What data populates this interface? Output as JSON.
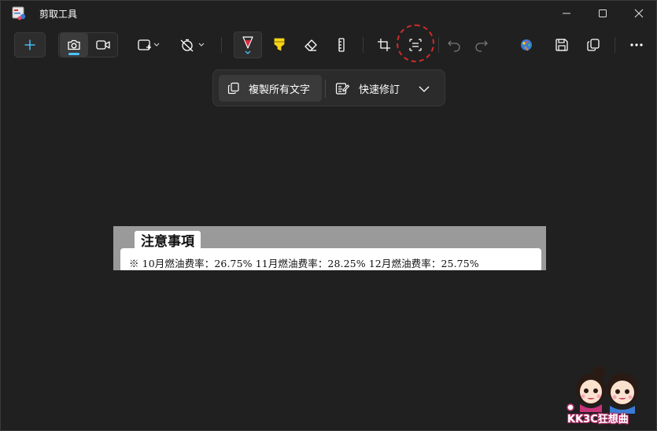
{
  "window": {
    "title": "剪取工具",
    "controls": {
      "minimize": "minimize-icon",
      "maximize": "maximize-icon",
      "close": "close-icon"
    }
  },
  "toolbar": {
    "buttons": [
      {
        "name": "new-snip",
        "icon": "plus-icon"
      },
      {
        "name": "snip-photo-mode",
        "icon": "camera-icon",
        "selected": true
      },
      {
        "name": "snip-video-mode",
        "icon": "video-camera-icon"
      },
      {
        "name": "snip-shape",
        "icon": "rectangle-select-icon"
      },
      {
        "name": "snip-delay",
        "icon": "timer-off-icon"
      },
      {
        "name": "ballpoint-pen",
        "icon": "pen-icon",
        "selected": true
      },
      {
        "name": "highlighter",
        "icon": "highlighter-icon"
      },
      {
        "name": "eraser",
        "icon": "eraser-icon"
      },
      {
        "name": "ruler",
        "icon": "ruler-icon"
      },
      {
        "name": "crop",
        "icon": "crop-icon"
      },
      {
        "name": "text-actions",
        "icon": "text-actions-icon",
        "highlighted": true
      },
      {
        "name": "undo",
        "icon": "undo-icon"
      },
      {
        "name": "redo",
        "icon": "redo-icon"
      },
      {
        "name": "paint",
        "icon": "paint-icon"
      },
      {
        "name": "save",
        "icon": "save-icon"
      },
      {
        "name": "copy",
        "icon": "copy-icon"
      },
      {
        "name": "more",
        "icon": "more-icon"
      }
    ],
    "accent_color": "#4cc2ff",
    "pen_color": "#e0283e",
    "highlighter_color": "#f5d416",
    "annotation_color": "#cc2b2b"
  },
  "text_actions": {
    "copy_all_text": "複製所有文字",
    "quick_redact": "快速修訂"
  },
  "capture": {
    "heading": "注意事項",
    "line": "※  10月燃油费率：26.75% 11月燃油费率：28.25% 12月燃油费率：25.75%"
  },
  "watermark": {
    "text": "KK3C狂想曲"
  }
}
